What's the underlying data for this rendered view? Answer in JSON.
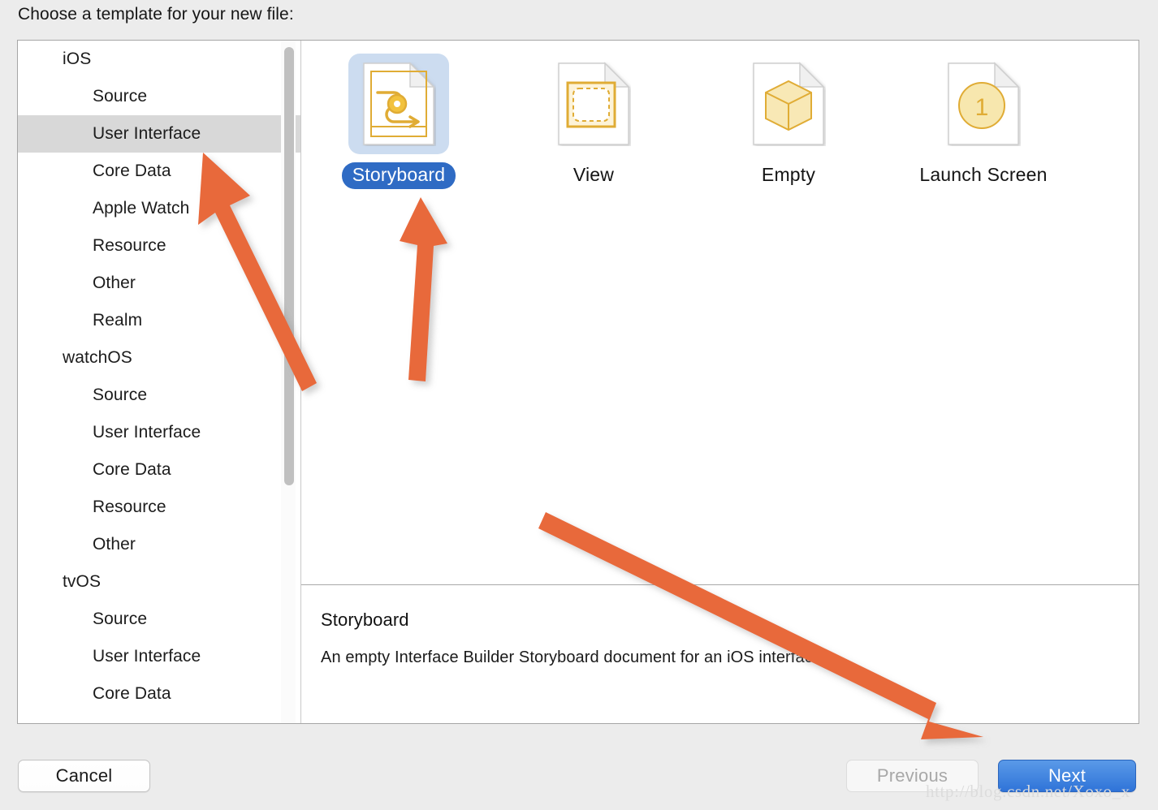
{
  "dialog": {
    "title": "Choose a template for your new file:"
  },
  "sidebar": {
    "selected": "User Interface",
    "rows": [
      {
        "label": "iOS",
        "type": "group",
        "selected": false
      },
      {
        "label": "Source",
        "type": "child",
        "selected": false
      },
      {
        "label": "User Interface",
        "type": "child",
        "selected": true
      },
      {
        "label": "Core Data",
        "type": "child",
        "selected": false
      },
      {
        "label": "Apple Watch",
        "type": "child",
        "selected": false
      },
      {
        "label": "Resource",
        "type": "child",
        "selected": false
      },
      {
        "label": "Other",
        "type": "child",
        "selected": false
      },
      {
        "label": "Realm",
        "type": "child",
        "selected": false
      },
      {
        "label": "watchOS",
        "type": "group",
        "selected": false
      },
      {
        "label": "Source",
        "type": "child",
        "selected": false
      },
      {
        "label": "User Interface",
        "type": "child",
        "selected": false
      },
      {
        "label": "Core Data",
        "type": "child",
        "selected": false
      },
      {
        "label": "Resource",
        "type": "child",
        "selected": false
      },
      {
        "label": "Other",
        "type": "child",
        "selected": false
      },
      {
        "label": "tvOS",
        "type": "group",
        "selected": false
      },
      {
        "label": "Source",
        "type": "child",
        "selected": false
      },
      {
        "label": "User Interface",
        "type": "child",
        "selected": false
      },
      {
        "label": "Core Data",
        "type": "child",
        "selected": false
      }
    ],
    "scrollbar": {
      "name": "vertical-scrollbar"
    }
  },
  "templates": [
    {
      "label": "Storyboard",
      "icon": "storyboard-document-icon",
      "selected": true
    },
    {
      "label": "View",
      "icon": "view-document-icon",
      "selected": false
    },
    {
      "label": "Empty",
      "icon": "empty-cube-document-icon",
      "selected": false
    },
    {
      "label": "Launch Screen",
      "icon": "launch-screen-document-icon",
      "selected": false
    }
  ],
  "description": {
    "title": "Storyboard",
    "body": "An empty Interface Builder Storyboard document for an iOS interface."
  },
  "footer": {
    "cancel_label": "Cancel",
    "previous_label": "Previous",
    "previous_enabled": false,
    "next_label": "Next",
    "next_enabled": true
  },
  "watermark": {
    "text": "http://blog.csdn.net/Xoxo_x"
  },
  "annotations": {
    "color": "#e8693a",
    "arrows": [
      {
        "name": "arrow-to-user-interface",
        "points_to": "User Interface"
      },
      {
        "name": "arrow-to-storyboard",
        "points_to": "Storyboard"
      },
      {
        "name": "arrow-to-next-button",
        "points_to": "Next"
      }
    ]
  },
  "colors": {
    "window_background": "#ececec",
    "selection_row": "#d8d8d8",
    "selection_icon_background": "#ccdcf0",
    "selection_pill": "#2f6bc4",
    "next_button": "#2f73d8",
    "annotation_orange": "#e8693a",
    "icon_yellow": "#e0ac35"
  }
}
